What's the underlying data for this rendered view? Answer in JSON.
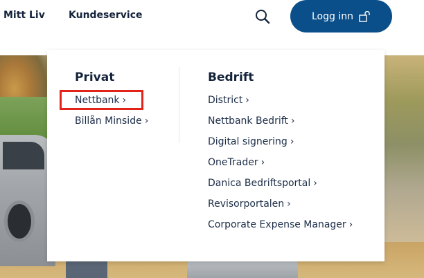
{
  "header": {
    "nav": [
      "Mitt Liv",
      "Kundeservice"
    ],
    "login_label": "Logg inn",
    "accent_color": "#0b4f8a"
  },
  "icons": {
    "search": "search-icon",
    "login": "lock-open-icon",
    "chevron": "chevron-right-icon"
  },
  "dropdown": {
    "privat": {
      "title": "Privat",
      "items": [
        "Nettbank",
        "Billån Minside"
      ]
    },
    "bedrift": {
      "title": "Bedrift",
      "items": [
        "District",
        "Nettbank Bedrift",
        "Digital signering",
        "OneTrader",
        "Danica Bedriftsportal",
        "Revisorportalen",
        "Corporate Expense Manager"
      ]
    },
    "highlight_color": "#e2231a"
  }
}
